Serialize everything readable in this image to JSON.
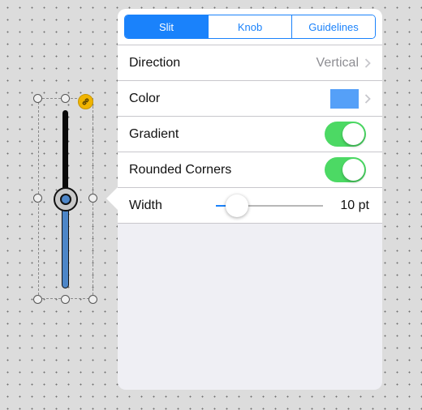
{
  "segments": {
    "slit": "Slit",
    "knob": "Knob",
    "guidelines": "Guidelines",
    "selected": "Slit"
  },
  "rows": {
    "direction": {
      "label": "Direction",
      "value": "Vertical"
    },
    "color": {
      "label": "Color",
      "swatch": "#55a0f8"
    },
    "gradient": {
      "label": "Gradient",
      "on": true
    },
    "rounded_corners": {
      "label": "Rounded Corners",
      "on": true
    },
    "width": {
      "label": "Width",
      "value_text": "10 pt",
      "slider_fraction": 0.2
    }
  },
  "icons": {
    "link_badge": "link-icon",
    "chevrons": "chevron-right-icon"
  },
  "colors": {
    "accent": "#1a82fb",
    "toggle_on": "#4cd964",
    "slider_fill": "#4d86c8",
    "badge": "#f0b400"
  }
}
